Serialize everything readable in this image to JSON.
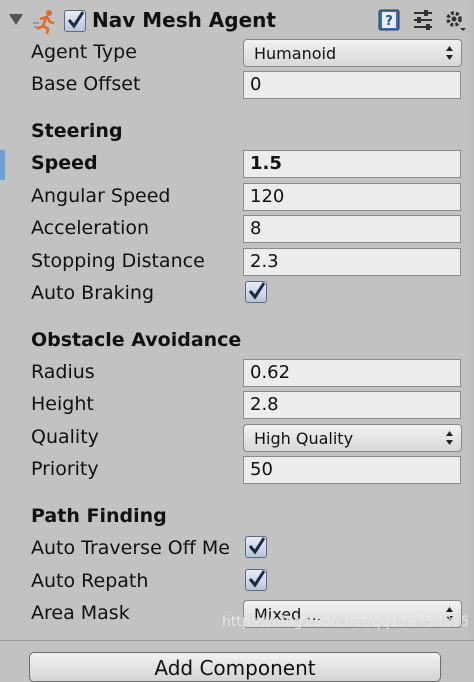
{
  "component": {
    "title": "Nav Mesh Agent",
    "enabled": true,
    "icons": [
      "fold-arrow-icon",
      "nav-mesh-agent-icon",
      "help-book-icon",
      "preset-sliders-icon",
      "gear-icon"
    ]
  },
  "fields": {
    "agent_type": {
      "label": "Agent Type",
      "value": "Humanoid"
    },
    "base_offset": {
      "label": "Base Offset",
      "value": "0"
    }
  },
  "steering": {
    "header": "Steering",
    "speed": {
      "label": "Speed",
      "value": "1.5"
    },
    "angular_speed": {
      "label": "Angular Speed",
      "value": "120"
    },
    "acceleration": {
      "label": "Acceleration",
      "value": "8"
    },
    "stopping_distance": {
      "label": "Stopping Distance",
      "value": "2.3"
    },
    "auto_braking": {
      "label": "Auto Braking",
      "checked": true
    }
  },
  "obstacle_avoidance": {
    "header": "Obstacle Avoidance",
    "radius": {
      "label": "Radius",
      "value": "0.62"
    },
    "height": {
      "label": "Height",
      "value": "2.8"
    },
    "quality": {
      "label": "Quality",
      "value": "High Quality"
    },
    "priority": {
      "label": "Priority",
      "value": "50"
    }
  },
  "path_finding": {
    "header": "Path Finding",
    "auto_traverse": {
      "label": "Auto Traverse Off Me",
      "checked": true
    },
    "auto_repath": {
      "label": "Auto Repath",
      "checked": true
    },
    "area_mask": {
      "label": "Area Mask",
      "value": "Mixed ..."
    }
  },
  "add_component_label": "Add Component",
  "watermark": "https://blog.csdn.net/qq13973837572",
  "colors": {
    "panel": "#c2c2c2",
    "field": "#ececec",
    "focus": "#6aa0d6",
    "check": "#1a2a40"
  }
}
